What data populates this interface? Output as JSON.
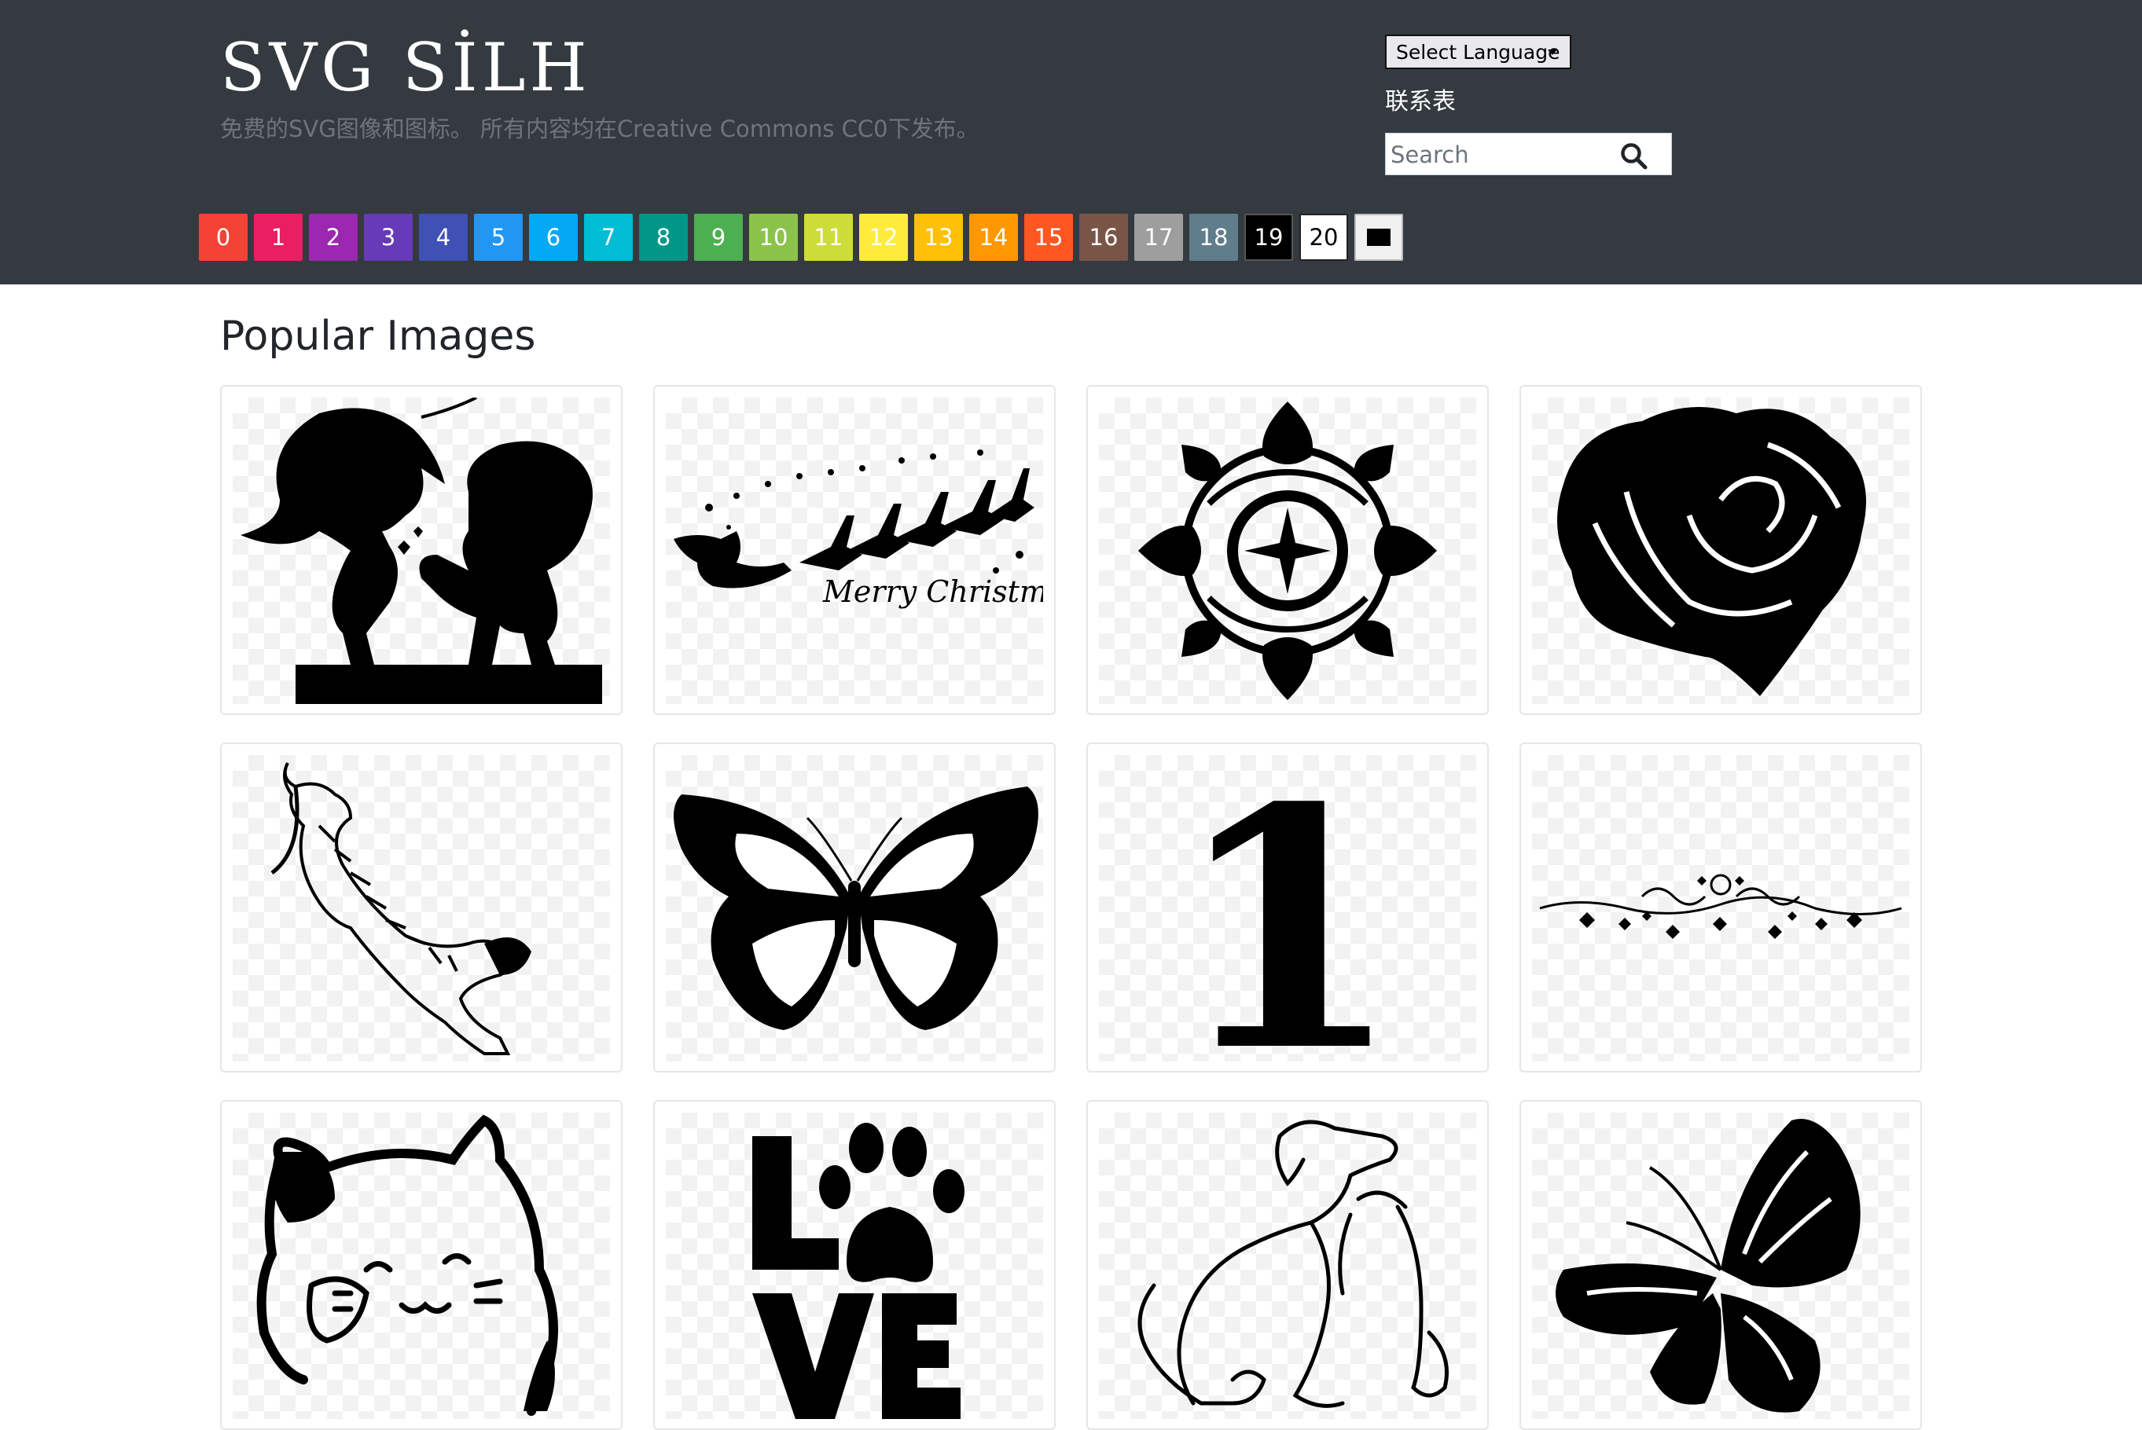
{
  "site": {
    "title": "SVG SİLH",
    "subtitle": "免费的SVG图像和图标。 所有内容均在Creative Commons CC0下发布。"
  },
  "header": {
    "language_label": "Select Language",
    "contact_label": "联系表",
    "search_placeholder": "Search",
    "search_icon": "search-icon"
  },
  "color_filters": [
    {
      "label": "0",
      "color": "#f44336"
    },
    {
      "label": "1",
      "color": "#e91e63"
    },
    {
      "label": "2",
      "color": "#9c27b0"
    },
    {
      "label": "3",
      "color": "#673ab7"
    },
    {
      "label": "4",
      "color": "#3f51b5"
    },
    {
      "label": "5",
      "color": "#2196f3"
    },
    {
      "label": "6",
      "color": "#03a9f4"
    },
    {
      "label": "7",
      "color": "#00bcd4"
    },
    {
      "label": "8",
      "color": "#009688"
    },
    {
      "label": "9",
      "color": "#4caf50"
    },
    {
      "label": "10",
      "color": "#8bc34a"
    },
    {
      "label": "11",
      "color": "#cddc39"
    },
    {
      "label": "12",
      "color": "#ffeb3b"
    },
    {
      "label": "13",
      "color": "#ffc107"
    },
    {
      "label": "14",
      "color": "#ff9800"
    },
    {
      "label": "15",
      "color": "#ff5722"
    },
    {
      "label": "16",
      "color": "#795548"
    },
    {
      "label": "17",
      "color": "#9e9e9e"
    },
    {
      "label": "18",
      "color": "#607d8b"
    },
    {
      "label": "19",
      "color": "#000000"
    },
    {
      "label": "20",
      "color": "#ffffff"
    },
    {
      "label": "",
      "color": "#f0f0f0",
      "icon": "black-square-icon"
    }
  ],
  "main": {
    "section_title": "Popular Images",
    "images": [
      {
        "name": "kissing-kids-silhouette"
      },
      {
        "name": "santa-sleigh-merry-christmas",
        "caption": "Merry Christmas"
      },
      {
        "name": "celtic-mandala"
      },
      {
        "name": "rose-silhouette"
      },
      {
        "name": "leaping-tiger"
      },
      {
        "name": "monarch-butterfly"
      },
      {
        "name": "number-one",
        "caption": "1"
      },
      {
        "name": "floral-divider"
      },
      {
        "name": "lucky-cat"
      },
      {
        "name": "love-paw-print",
        "caption": "LVE"
      },
      {
        "name": "dog-line-art"
      },
      {
        "name": "butterfly-silhouette"
      }
    ]
  }
}
